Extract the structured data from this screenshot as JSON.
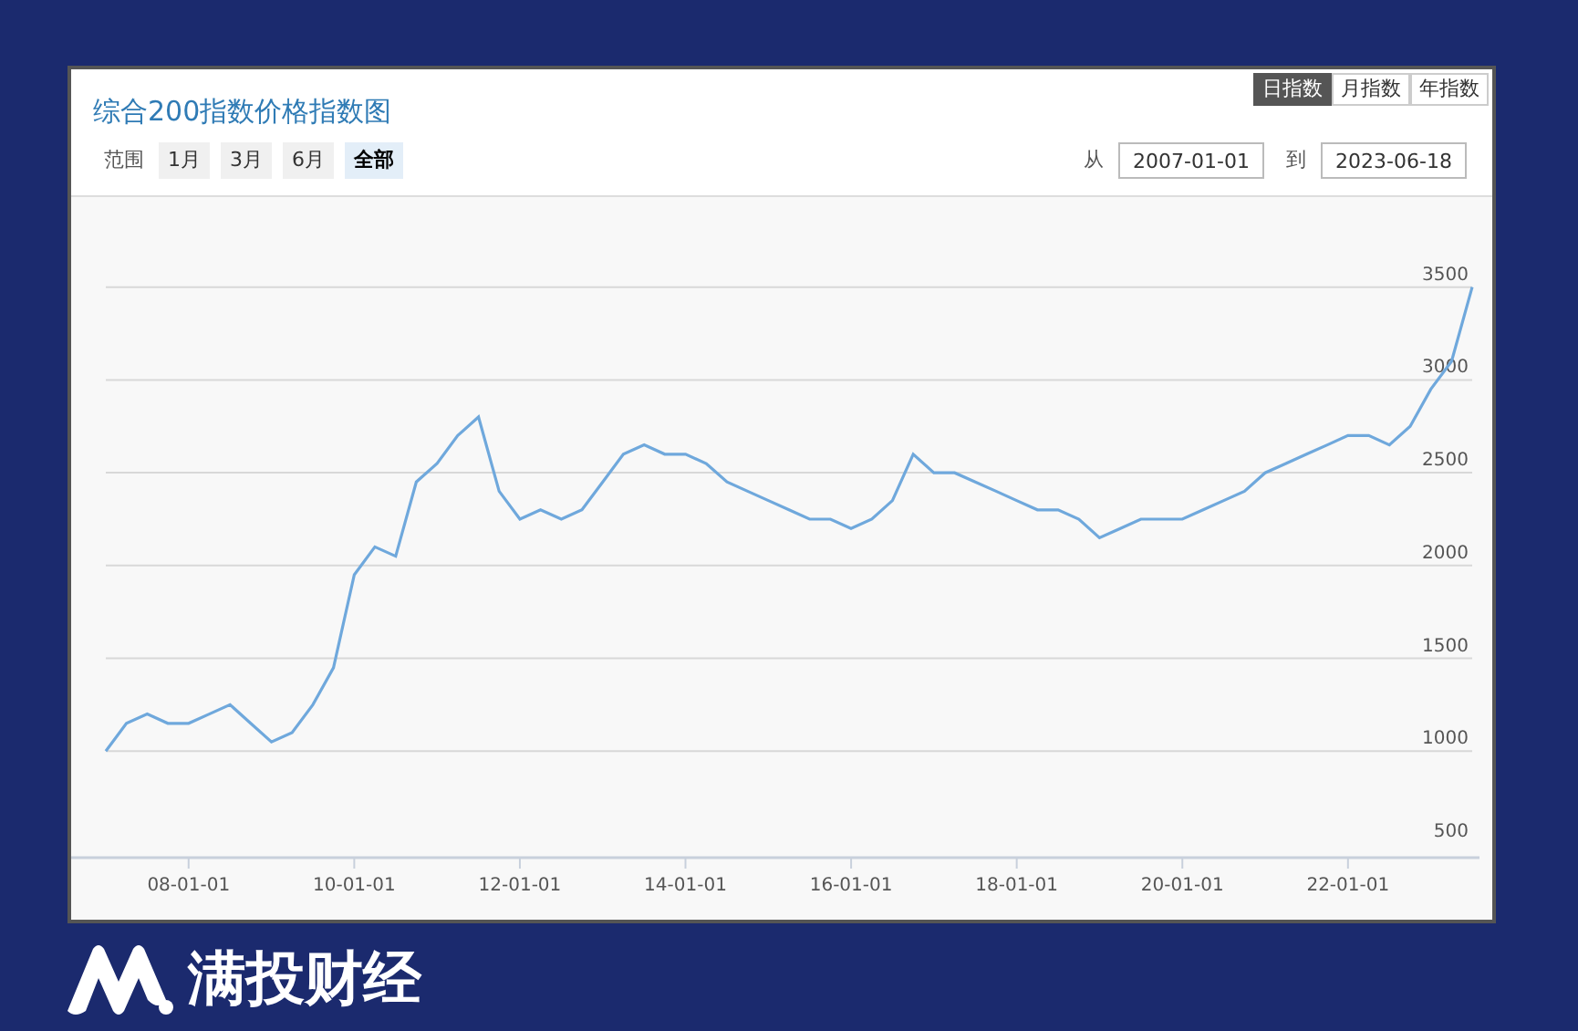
{
  "title": "综合200指数价格指数图",
  "period_tabs": [
    {
      "label": "日指数",
      "selected": true
    },
    {
      "label": "月指数",
      "selected": false
    },
    {
      "label": "年指数",
      "selected": false
    }
  ],
  "range": {
    "label": "范围",
    "buttons": [
      {
        "label": "1月",
        "selected": false
      },
      {
        "label": "3月",
        "selected": false
      },
      {
        "label": "6月",
        "selected": false
      },
      {
        "label": "全部",
        "selected": true
      }
    ]
  },
  "date_from": {
    "label": "从",
    "value": "2007-01-01"
  },
  "date_to": {
    "label": "到",
    "value": "2023-06-18"
  },
  "chart_data": {
    "type": "line",
    "grid": true,
    "ylim": [
      92,
      3985
    ],
    "yticks": [
      500,
      1000,
      1500,
      2000,
      2500,
      3000,
      3500
    ],
    "categories": [
      null,
      null,
      null,
      null,
      "08-01-01",
      null,
      null,
      null,
      null,
      null,
      null,
      null,
      "10-01-01",
      null,
      null,
      null,
      null,
      null,
      null,
      null,
      "12-01-01",
      null,
      null,
      null,
      null,
      null,
      null,
      null,
      "14-01-01",
      null,
      null,
      null,
      null,
      null,
      null,
      null,
      "16-01-01",
      null,
      null,
      null,
      null,
      null,
      null,
      null,
      "18-01-01",
      null,
      null,
      null,
      null,
      null,
      null,
      null,
      "20-01-01",
      null,
      null,
      null,
      null,
      null,
      null,
      null,
      "22-01-01",
      null,
      null,
      null,
      null,
      null,
      null
    ],
    "series": [
      {
        "color": "#6fa8dc",
        "values": [
          1000,
          1150,
          1200,
          1150,
          1150,
          1200,
          1250,
          1150,
          1050,
          1100,
          1250,
          1450,
          1950,
          2100,
          2050,
          2450,
          2550,
          2700,
          2800,
          2400,
          2250,
          2300,
          2250,
          2300,
          2450,
          2600,
          2650,
          2600,
          2600,
          2550,
          2450,
          2400,
          2350,
          2300,
          2250,
          2250,
          2200,
          2250,
          2350,
          2600,
          2500,
          2500,
          2450,
          2400,
          2350,
          2300,
          2300,
          2250,
          2150,
          2200,
          2250,
          2250,
          2250,
          2300,
          2350,
          2400,
          2500,
          2550,
          2600,
          2650,
          2700,
          2700,
          2650,
          2750,
          2950,
          3100,
          3500
        ]
      }
    ]
  },
  "brand": {
    "name": "满投财经"
  }
}
